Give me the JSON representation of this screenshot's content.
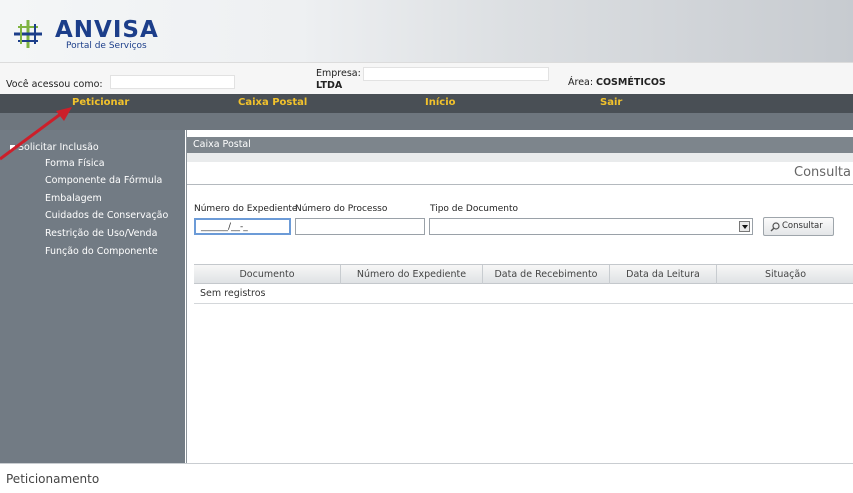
{
  "header": {
    "brand": "ANVISA",
    "subtitle": "Portal de Serviços"
  },
  "userbar": {
    "accessed_as_label": "Você acessou como:",
    "company_label": "Empresa:",
    "company_suffix": "LTDA",
    "area_label": "Área:",
    "area_value": "COSMÉTICOS"
  },
  "nav": {
    "items": [
      "Peticionar",
      "Caixa Postal",
      "Início",
      "Sair"
    ]
  },
  "sidebar": {
    "items": [
      "Solicitar Inclusão",
      "Forma Física",
      "Componente da Fórmula",
      "Embalagem",
      "Cuidados de Conservação",
      "Restrição de Uso/Venda",
      "Função do Componente"
    ]
  },
  "panel": {
    "title": "Caixa Postal",
    "section_title": "Consulta",
    "fields": {
      "expediente_label": "Número do Expediente",
      "expediente_placeholder": "______/__-_",
      "processo_label": "Número do Processo",
      "tipo_label": "Tipo de Documento"
    },
    "consult_button": "Consultar",
    "table": {
      "columns": [
        "Documento",
        "Número do Expediente",
        "Data de Recebimento",
        "Data da Leitura",
        "Situação"
      ],
      "empty_text": "Sem registros"
    }
  },
  "footer": {
    "text": "Peticionamento"
  },
  "colors": {
    "brand": "#1c3e8a",
    "nav_bg": "#494f55",
    "nav_text": "#f2c22c",
    "sidebar_bg": "#727b84",
    "arrow": "#cc1f2a"
  }
}
